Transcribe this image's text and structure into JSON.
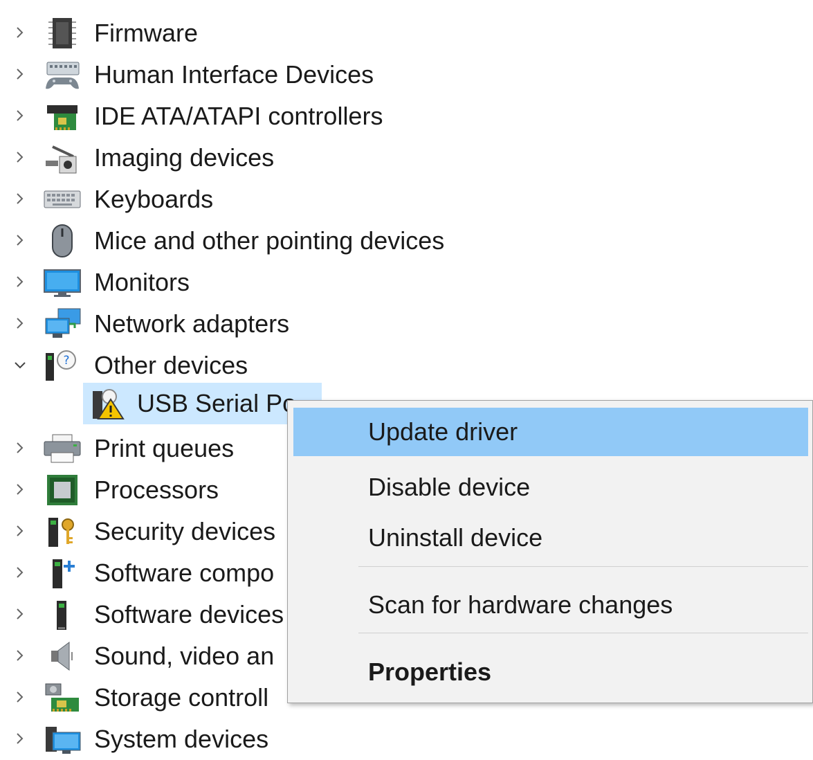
{
  "tree": {
    "items": [
      {
        "label": "Firmware",
        "icon": "firmware-chip-icon",
        "expanded": false
      },
      {
        "label": "Human Interface Devices",
        "icon": "human-interface-devices-icon",
        "expanded": false
      },
      {
        "label": "IDE ATA/ATAPI controllers",
        "icon": "ide-controller-icon",
        "expanded": false
      },
      {
        "label": "Imaging devices",
        "icon": "imaging-device-icon",
        "expanded": false
      },
      {
        "label": "Keyboards",
        "icon": "keyboard-icon",
        "expanded": false
      },
      {
        "label": "Mice and other pointing devices",
        "icon": "mouse-icon",
        "expanded": false
      },
      {
        "label": "Monitors",
        "icon": "monitor-icon",
        "expanded": false
      },
      {
        "label": "Network adapters",
        "icon": "network-adapter-icon",
        "expanded": false
      },
      {
        "label": "Other devices",
        "icon": "unknown-device-icon",
        "expanded": true
      },
      {
        "label": "Print queues",
        "icon": "printer-icon",
        "expanded": false
      },
      {
        "label": "Processors",
        "icon": "processor-icon",
        "expanded": false
      },
      {
        "label": "Security devices",
        "icon": "security-device-icon",
        "expanded": false
      },
      {
        "label": "Software compo",
        "icon": "software-component-icon",
        "expanded": false
      },
      {
        "label": "Software devices",
        "icon": "software-device-icon",
        "expanded": false
      },
      {
        "label": "Sound, video an",
        "icon": "speaker-icon",
        "expanded": false
      },
      {
        "label": "Storage controll",
        "icon": "storage-controller-icon",
        "expanded": false
      },
      {
        "label": "System devices",
        "icon": "system-device-icon",
        "expanded": false
      }
    ],
    "selected_child": {
      "label": "USB Serial Po",
      "icon": "warning-device-icon"
    }
  },
  "context_menu": {
    "items": [
      {
        "label": "Update driver",
        "highlighted": true
      },
      {
        "label": "Disable device"
      },
      {
        "label": "Uninstall device"
      },
      {
        "label": "Scan for hardware changes"
      },
      {
        "label": "Properties",
        "bold": true
      }
    ]
  },
  "colors": {
    "selection": "#cce8ff",
    "menu_highlight": "#91c9f7",
    "menu_background": "#f2f2f2",
    "warning": "#f5c400"
  }
}
